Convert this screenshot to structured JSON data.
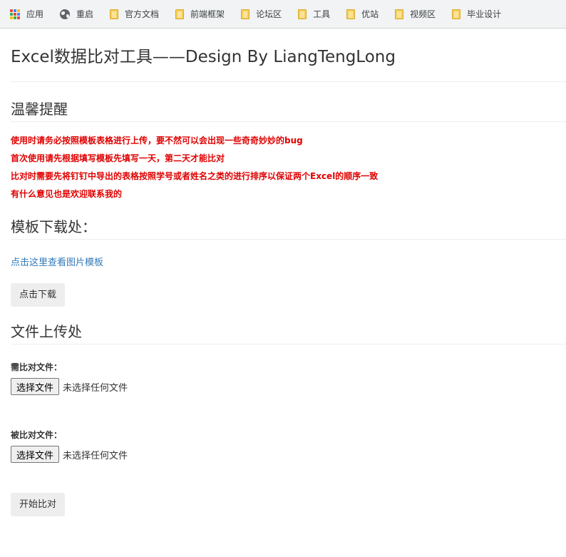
{
  "bookmarks": [
    {
      "label": "应用",
      "icon": "apps-icon"
    },
    {
      "label": "重启",
      "icon": "globe-icon"
    },
    {
      "label": "官方文档",
      "icon": "folder-icon"
    },
    {
      "label": "前端框架",
      "icon": "folder-icon"
    },
    {
      "label": "论坛区",
      "icon": "folder-icon"
    },
    {
      "label": "工具",
      "icon": "folder-icon"
    },
    {
      "label": "优站",
      "icon": "folder-icon"
    },
    {
      "label": "视频区",
      "icon": "folder-icon"
    },
    {
      "label": "毕业设计",
      "icon": "folder-icon"
    }
  ],
  "apps_icon_colors": [
    "#ea4335",
    "#4285f4",
    "#fbbc05",
    "#34a853",
    "#ea4335",
    "#4285f4",
    "#fbbc05",
    "#34a853",
    "#ea4335"
  ],
  "page": {
    "title": "Excel数据比对工具——Design By LiangTengLong"
  },
  "tips": {
    "heading": "温馨提醒",
    "color": "#e00000",
    "lines": [
      "使用时请务必按照模板表格进行上传，要不然可以会出现一些奇奇妙妙的bug",
      "首次使用请先根据填写模板先填写一天，第二天才能比对",
      "比对时需要先将钉钉中导出的表格按照学号或者姓名之类的进行排序以保证两个Excel的顺序一致",
      "有什么意见也是欢迎联系我的"
    ]
  },
  "template": {
    "heading": "模板下载处：",
    "view_link": "点击这里查看图片模板",
    "link_color": "#337ab7",
    "download_button": "点击下载"
  },
  "upload": {
    "heading": "文件上传处",
    "field1_label": "需比对文件：",
    "field2_label": "被比对文件：",
    "choose_button": "选择文件",
    "no_file_text": "未选择任何文件",
    "start_button": "开始比对"
  }
}
